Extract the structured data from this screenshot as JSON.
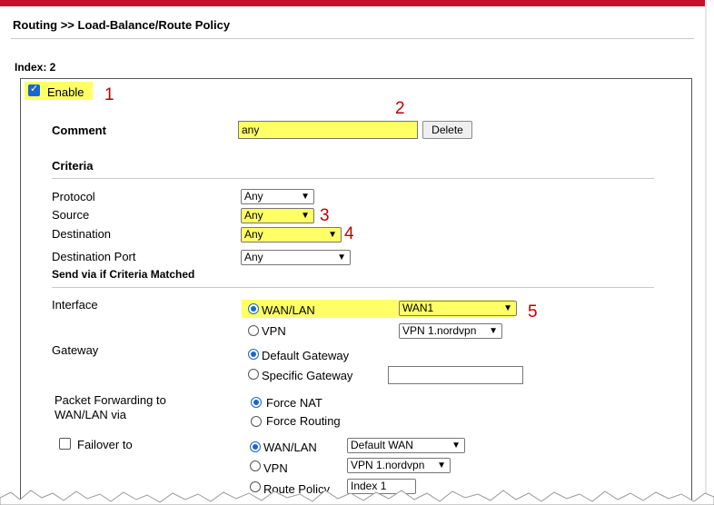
{
  "header": {
    "title": "Routing >> Load-Balance/Route Policy",
    "index_label": "Index: 2"
  },
  "enable": {
    "label": "Enable",
    "checked": true
  },
  "comment": {
    "label": "Comment",
    "value": "any",
    "delete_label": "Delete"
  },
  "criteria": {
    "heading": "Criteria",
    "protocol": {
      "label": "Protocol",
      "value": "Any"
    },
    "source": {
      "label": "Source",
      "value": "Any"
    },
    "destination": {
      "label": "Destination",
      "value": "Any"
    },
    "destination_port": {
      "label": "Destination Port",
      "value": "Any"
    }
  },
  "send_via": {
    "heading": "Send via if Criteria Matched",
    "interface": {
      "label": "Interface",
      "wan_lan": "WAN/LAN",
      "wan_value": "WAN1",
      "vpn": "VPN",
      "vpn_value": "VPN 1.nordvpn"
    },
    "gateway": {
      "label": "Gateway",
      "default": "Default Gateway",
      "specific": "Specific Gateway",
      "specific_value": ""
    },
    "packet_forwarding": {
      "label_line1": "Packet Forwarding to",
      "label_line2": "WAN/LAN via",
      "force_nat": "Force NAT",
      "force_routing": "Force Routing"
    },
    "failover": {
      "label": "Failover to",
      "wan_lan": "WAN/LAN",
      "wan_value": "Default WAN",
      "vpn": "VPN",
      "vpn_value": "VPN 1.nordvpn",
      "route_policy": "Route Policy",
      "route_value": "Index 1"
    }
  },
  "annotations": {
    "n1": "1",
    "n2": "2",
    "n3": "3",
    "n4": "4",
    "n5": "5"
  },
  "colors": {
    "highlight": "#ffff66",
    "annotation": "#c00000",
    "accent": "#1a66d0",
    "top_bar": "#c8102e"
  }
}
